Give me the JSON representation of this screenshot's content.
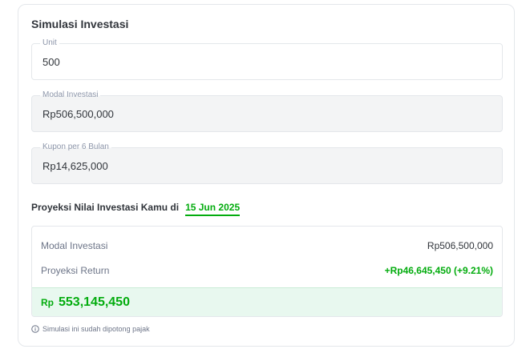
{
  "card": {
    "title": "Simulasi Investasi"
  },
  "fields": {
    "unit": {
      "label": "Unit",
      "value": "500"
    },
    "modal": {
      "label": "Modal Investasi",
      "value": "Rp506,500,000"
    },
    "kupon": {
      "label": "Kupon per 6 Bulan",
      "value": "Rp14,625,000"
    }
  },
  "projection": {
    "heading": "Proyeksi Nilai Investasi Kamu di",
    "date": "15 Jun 2025",
    "rows": [
      {
        "label": "Modal Investasi",
        "value": "Rp506,500,000"
      },
      {
        "label": "Proyeksi Return",
        "value": "+Rp46,645,450 (+9.21%)"
      }
    ],
    "total_currency": "Rp",
    "total_amount": "553,145,450"
  },
  "note": {
    "icon": "info-icon",
    "text": "Simulasi ini sudah dipotong pajak"
  },
  "colors": {
    "accent": "#03ac0e",
    "total_bg": "#e8f8ef",
    "border": "#e4e7eb",
    "readonly_bg": "#f3f4f5"
  }
}
